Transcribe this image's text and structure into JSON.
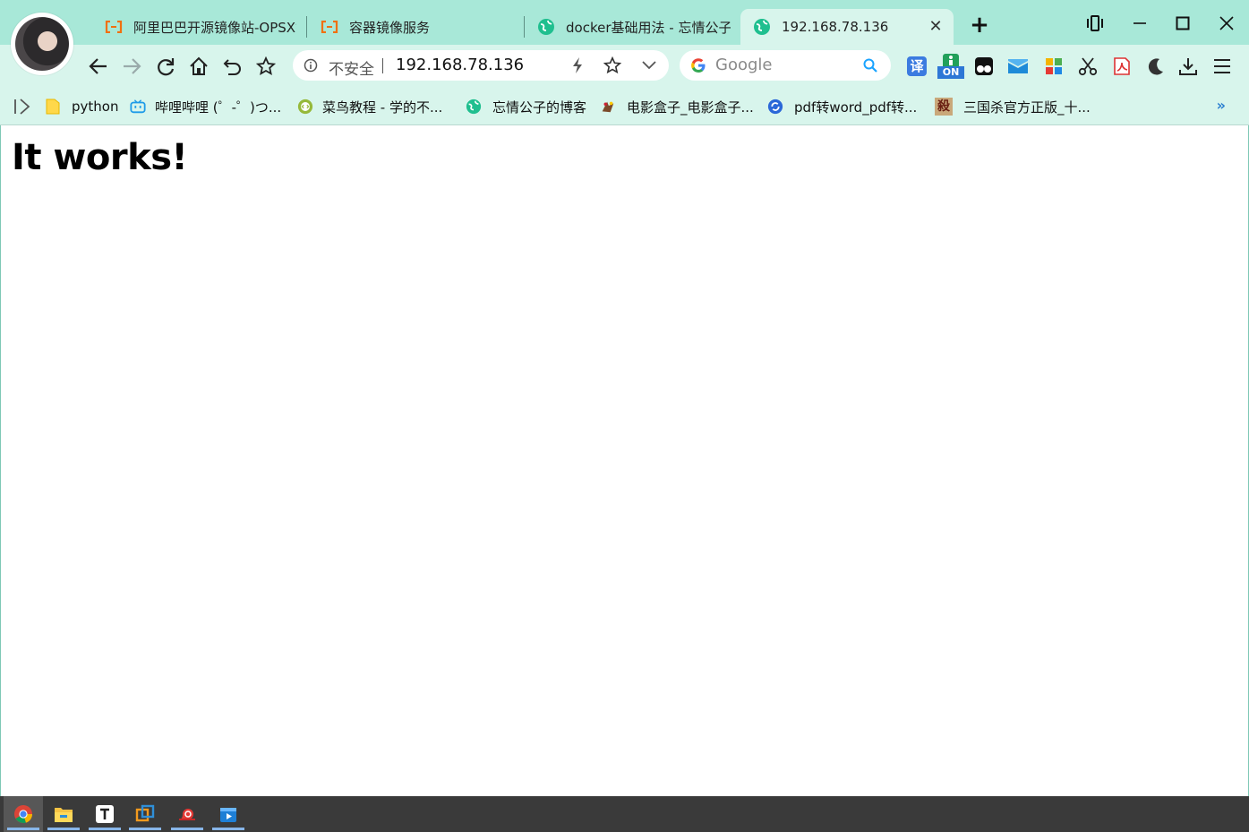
{
  "browser": {
    "tabs": [
      {
        "title": "阿里巴巴开源镜像站-OPSX镜",
        "icon": "aliyun-icon",
        "active": false
      },
      {
        "title": "容器镜像服务",
        "icon": "aliyun-icon",
        "active": false
      },
      {
        "title": "docker基础用法 - 忘情公子",
        "icon": "blog-globe-icon",
        "active": false
      },
      {
        "title": "192.168.78.136",
        "icon": "blog-globe-icon",
        "active": true
      }
    ],
    "new_tab_label": "+",
    "close_tab_label": "✕",
    "address": {
      "security_label": "不安全",
      "url": "192.168.78.136"
    },
    "search": {
      "engine_placeholder": "Google"
    },
    "extensions": [
      "translate-icon",
      "on-toggle-icon",
      "tampermonkey-icon",
      "mail-icon",
      "apps-grid-icon",
      "scissors-icon",
      "pdf-icon",
      "dark-mode-icon",
      "download-icon",
      "menu-icon"
    ],
    "extension_on_label": "ON",
    "extension_translate_label": "译",
    "bookmarks": [
      {
        "label": "python",
        "icon": "folder-icon"
      },
      {
        "label": "哔哩哔哩 (゜-゜)つ...",
        "icon": "bilibili-icon"
      },
      {
        "label": "菜鸟教程 - 学的不...",
        "icon": "runoob-icon"
      },
      {
        "label": "忘情公子的博客",
        "icon": "blog-globe-icon"
      },
      {
        "label": "电影盒子_电影盒子...",
        "icon": "movie-box-icon"
      },
      {
        "label": "pdf转word_pdf转...",
        "icon": "pdf-convert-icon"
      },
      {
        "label": "三国杀官方正版_十...",
        "icon": "sanguosha-icon"
      }
    ],
    "bookmarks_more": "»",
    "sanguosha_glyph": "殺"
  },
  "page": {
    "heading": "It works!"
  },
  "taskbar": {
    "apps": [
      "chrome-icon",
      "file-explorer-icon",
      "typora-icon",
      "vmware-icon",
      "snail-app-icon",
      "media-player-icon"
    ]
  },
  "colors": {
    "chrome_bg": "#a8e8d8",
    "toolbar_bg": "#d8f5ec",
    "taskbar_bg": "#3a3a3a",
    "accent": "#2b7fd0"
  }
}
